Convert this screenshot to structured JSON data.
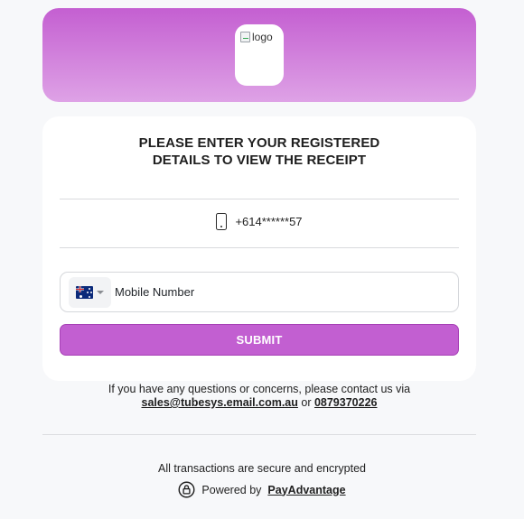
{
  "header": {
    "logo_alt": "logo",
    "gradient_top": "#c45fd1",
    "gradient_bottom": "#dea2e6"
  },
  "card": {
    "title_line1": "PLEASE ENTER YOUR REGISTERED",
    "title_line2": "DETAILS TO VIEW THE RECEIPT",
    "masked_phone": "+614******57",
    "phone_icon": "smartphone-icon",
    "country_flag": "australia-flag",
    "mobile_placeholder": "Mobile Number",
    "submit_label": "SUBMIT",
    "accent": "#c25fd1"
  },
  "contact": {
    "text_before": "If you have any questions or concerns, please contact us via ",
    "email": "sales@tubesys.email.com.au",
    "text_or": " or ",
    "phone": "0879370226"
  },
  "footer": {
    "secure_text": "All transactions are secure and encrypted",
    "powered_prefix": "Powered by",
    "powered_brand": "PayAdvantage",
    "lock_icon": "lock-icon"
  }
}
